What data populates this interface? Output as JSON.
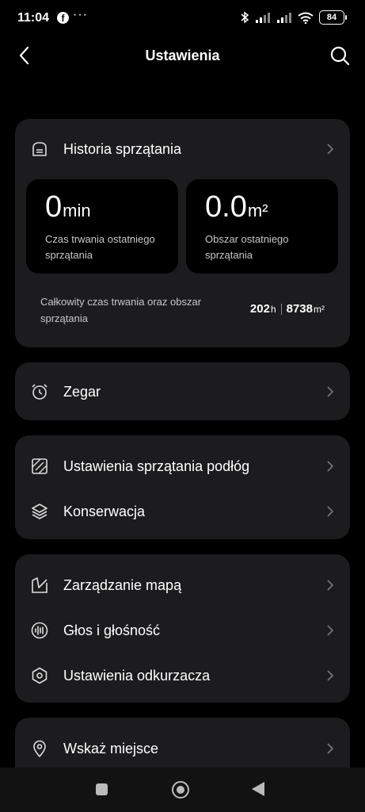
{
  "status_bar": {
    "time": "11:04",
    "more": "···",
    "battery": "84"
  },
  "header": {
    "title": "Ustawienia"
  },
  "history": {
    "label": "Historia sprzątania",
    "last_duration": {
      "value": "0",
      "unit": "min",
      "desc": "Czas trwania ostatniego sprzątania"
    },
    "last_area": {
      "value": "0.0",
      "unit": "m²",
      "desc": "Obszar ostatniego sprzątania"
    },
    "total": {
      "label": "Całkowity czas trwania oraz obszar sprzątania",
      "hours": "202",
      "hours_unit": "h",
      "area": "8738",
      "area_unit": "m²"
    }
  },
  "clock": {
    "label": "Zegar"
  },
  "group_floor": {
    "items": [
      {
        "label": "Ustawienia sprzątania podłóg"
      },
      {
        "label": "Konserwacja"
      }
    ]
  },
  "group_map": {
    "items": [
      {
        "label": "Zarządzanie mapą"
      },
      {
        "label": "Głos i głośność"
      },
      {
        "label": "Ustawienia odkurzacza"
      }
    ]
  },
  "locate": {
    "label": "Wskaż miejsce"
  }
}
